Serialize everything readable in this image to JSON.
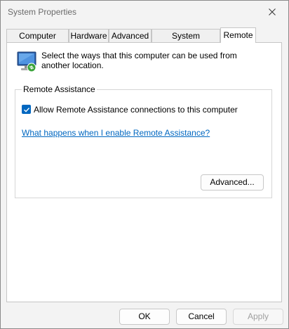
{
  "window": {
    "title": "System Properties",
    "close_icon": "close-icon"
  },
  "tabs": [
    {
      "label": "Computer Name"
    },
    {
      "label": "Hardware"
    },
    {
      "label": "Advanced"
    },
    {
      "label": "System Protection"
    },
    {
      "label": "Remote",
      "active": true
    }
  ],
  "remote": {
    "intro": "Select the ways that this computer can be used from another location.",
    "assistance": {
      "group_title": "Remote Assistance",
      "checkbox_label": "Allow Remote Assistance connections to this computer",
      "checked": true,
      "help_link": "What happens when I enable Remote Assistance?",
      "advanced_button": "Advanced..."
    }
  },
  "footer": {
    "ok": "OK",
    "cancel": "Cancel",
    "apply": "Apply"
  },
  "colors": {
    "accent": "#0067c0"
  }
}
